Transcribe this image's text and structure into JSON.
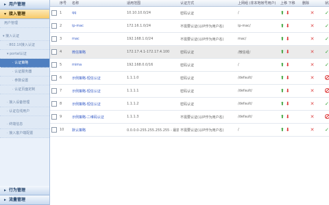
{
  "sidebar": {
    "top_header": "用户管理",
    "access_header": "接入管理",
    "user_mgmt": "用户管理",
    "access_auth": "接入认证",
    "sub_802": "802.1X接入认证",
    "portal": "portal认证",
    "portal_items": [
      "认证策略",
      "认证服务器",
      "参数设置",
      "认证页面定制"
    ],
    "group2": [
      "接入设备管理",
      "认证在线用户"
    ],
    "group3": [
      "终端信息",
      "接入客户端配置"
    ],
    "behavior_header": "行为管理",
    "flow_header": "流量管理"
  },
  "table": {
    "headers": [
      "序号",
      "名称",
      "适用范围",
      "认证方式",
      "上网组 (非本地帐号用户)",
      "上移 下移",
      "删除",
      "状态"
    ],
    "rows": [
      {
        "no": "1",
        "name": "qq",
        "range": "10.10.10.0/24",
        "auth": "密码认证",
        "group": "/",
        "status": "ok"
      },
      {
        "no": "2",
        "name": "ip-mac",
        "range": "172.16.1.0/24",
        "auth": "不需要认证(以IP作为用户名)",
        "group": "ip-mac/",
        "status": "ok"
      },
      {
        "no": "3",
        "name": "mac",
        "range": "192.168.1.0/24",
        "auth": "不需要认证(以IP作为用户名)",
        "group": "mac/",
        "status": "ok"
      },
      {
        "no": "4",
        "name": "微信策略",
        "range": "172.17.4.1-172.17.4.100",
        "auth": "密码认证",
        "group": "/微信组/",
        "status": "ok"
      },
      {
        "no": "5",
        "name": "mima",
        "range": "192.168.0.0/16",
        "auth": "密码认证",
        "group": "/",
        "status": "ok"
      },
      {
        "no": "6",
        "name": "示例策略-短信认证",
        "range": "1.1.1.0",
        "auth": "密码认证",
        "group": "/default/",
        "status": "no"
      },
      {
        "no": "7",
        "name": "示例策略-短信认证",
        "range": "1.1.1.1",
        "auth": "密码认证",
        "group": "/default/",
        "status": "no"
      },
      {
        "no": "8",
        "name": "示例策略-短信认证",
        "range": "1.1.1.2",
        "auth": "密码认证",
        "group": "/default/",
        "status": "ok"
      },
      {
        "no": "9",
        "name": "示例策略-二维码认证",
        "range": "1.1.1.3",
        "auth": "不需要认证(以IP作为用户名)",
        "group": "/default/",
        "status": "no"
      },
      {
        "no": "10",
        "name": "默认策略",
        "range": "0.0.0.0-255.255.255.255 - 最前...",
        "auth": "不需要认证(以IP作为用户名)",
        "group": "/",
        "status": "ok"
      }
    ]
  },
  "icons": {
    "up": "arrow-up-icon",
    "down": "arrow-down-icon",
    "delete": "delete-x-icon",
    "ok": "check-icon",
    "disabled": "no-entry-icon"
  },
  "colors": {
    "link": "#3a5fc8",
    "up": "#2f9e2f",
    "down": "#dd3333",
    "highlight_row": "#ebebeb",
    "sidebar_bg": "#dfe9f5"
  }
}
